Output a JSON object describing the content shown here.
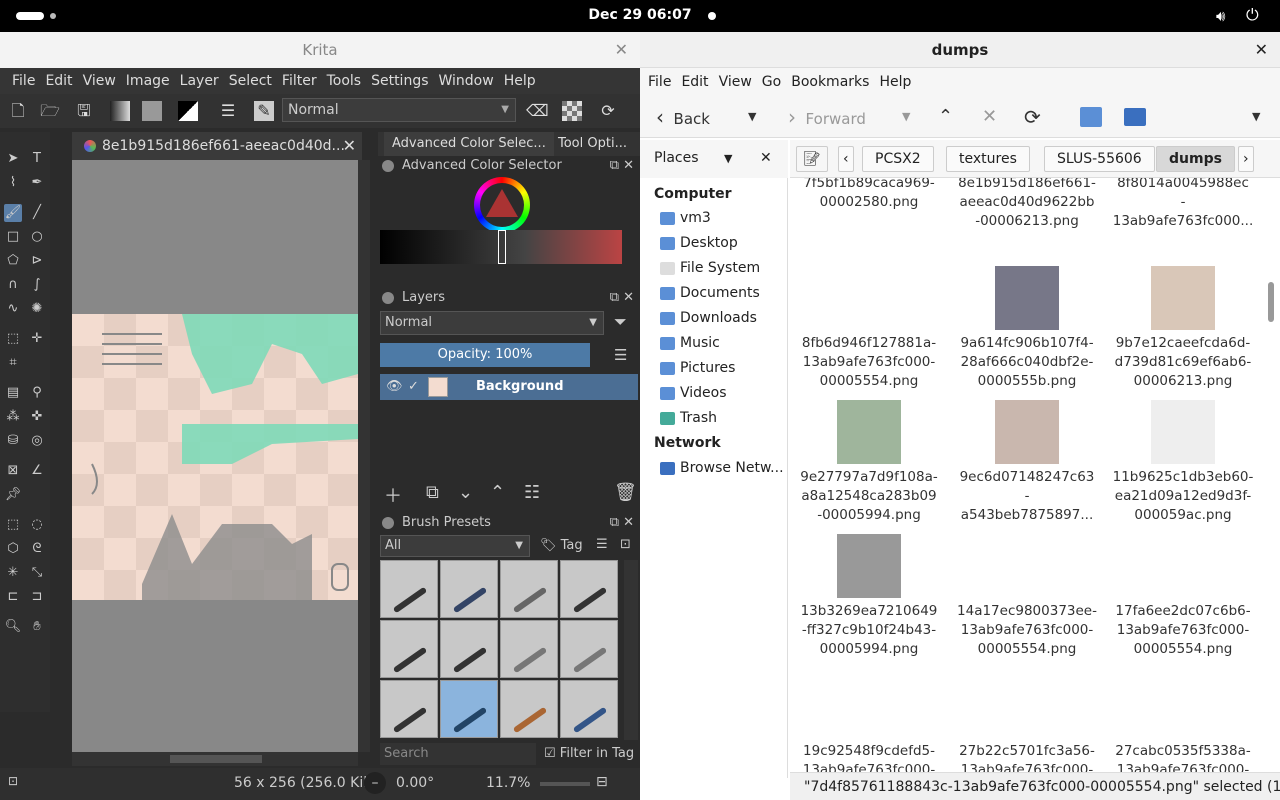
{
  "topbar": {
    "clock": "Dec 29  06:07"
  },
  "krita": {
    "title": "Krita",
    "menu": [
      "File",
      "Edit",
      "View",
      "Image",
      "Layer",
      "Select",
      "Filter",
      "Tools",
      "Settings",
      "Window",
      "Help"
    ],
    "blend_mode": "Normal",
    "doc_tab": "8e1b915d186ef661-aeeac0d40d...",
    "dock_tabs": [
      "Advanced Color Selec...",
      "Tool Opti..."
    ],
    "color_panel_title": "Advanced Color Selector",
    "layers_title": "Layers",
    "layer_mode": "Normal",
    "opacity": "Opacity:  100%",
    "layer_name": "Background",
    "presets_title": "Brush Presets",
    "preset_filter": "All",
    "tag_label": "Tag",
    "search_placeholder": "Search",
    "filter_in_tag": "Filter in Tag",
    "status_size": "56 x 256 (256.0 Kil",
    "status_angle": "0.00°",
    "status_zoom": "11.7%"
  },
  "fm": {
    "title": "dumps",
    "menu": [
      "File",
      "Edit",
      "View",
      "Go",
      "Bookmarks",
      "Help"
    ],
    "back": "Back",
    "forward": "Forward",
    "places_label": "Places",
    "breadcrumbs": [
      "PCSX2",
      "textures",
      "SLUS-55606",
      "dumps"
    ],
    "sidebar_computer": "Computer",
    "sidebar_items": [
      "vm3",
      "Desktop",
      "File System",
      "Documents",
      "Downloads",
      "Music",
      "Pictures",
      "Videos",
      "Trash"
    ],
    "sidebar_network": "Network",
    "sidebar_network_item": "Browse Netw...",
    "files": [
      {
        "name": "7f5bf1b89caca969-\n00002580.png",
        "thumb": "#ffffff"
      },
      {
        "name": "8e1b915d186ef661-\naeeac0d40d9622bb\n-00006213.png",
        "thumb": "#e8d5ca"
      },
      {
        "name": "8f8014a0045988ec\n-\n13ab9afe763fc000...",
        "thumb": "#ffffff"
      },
      {
        "name": "8fb6d946f127881a-\n13ab9afe763fc000-\n00005554.png",
        "thumb": "#ffffff"
      },
      {
        "name": "9a614fc906b107f4-\n28af666c040dbf2e-\n0000555b.png",
        "thumb": "#777788"
      },
      {
        "name": "9b7e12caeefcda6d-\nd739d81c69ef6ab6-\n00006213.png",
        "thumb": "#d9c7b8"
      },
      {
        "name": "9e27797a7d9f108a-\na8a12548ca283b09\n-00005994.png",
        "thumb": "#9fb59c"
      },
      {
        "name": "9ec6d07148247c63\n-\na543beb7875897...",
        "thumb": "#c9b7ae"
      },
      {
        "name": "11b9625c1db3eb60-\nea21d09a12ed9d3f-\n000059ac.png",
        "thumb": "#eeeeee"
      },
      {
        "name": "13b3269ea7210649\n-ff327c9b10f24b43-\n00005994.png",
        "thumb": "#999999"
      },
      {
        "name": "14a17ec9800373ee-\n13ab9afe763fc000-\n00005554.png",
        "thumb": "#ffffff"
      },
      {
        "name": "17fa6ee2dc07c6b6-\n13ab9afe763fc000-\n00005554.png",
        "thumb": "#ffffff"
      },
      {
        "name": "19c92548f9cdefd5-\n13ab9afe763fc000-",
        "thumb": "#ffffff"
      },
      {
        "name": "27b22c5701fc3a56-\n13ab9afe763fc000-",
        "thumb": "#ffffff"
      },
      {
        "name": "27cabc0535f5338a-\n13ab9afe763fc000-",
        "thumb": "#ffffff"
      }
    ],
    "status": "\"7d4f85761188843c-13ab9afe763fc000-00005554.png\" selected (1..."
  }
}
